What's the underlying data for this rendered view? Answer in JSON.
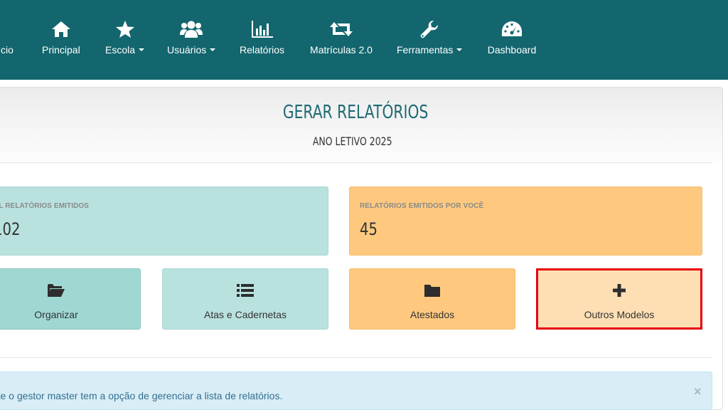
{
  "nav": {
    "partial_item_label": "cio",
    "items": [
      {
        "label": "Principal",
        "icon": "home-icon",
        "dropdown": false
      },
      {
        "label": "Escola",
        "icon": "star-icon",
        "dropdown": true
      },
      {
        "label": "Usuários",
        "icon": "users-icon",
        "dropdown": true
      },
      {
        "label": "Relatórios",
        "icon": "bar-chart-icon",
        "dropdown": false
      },
      {
        "label": "Matrículas 2.0",
        "icon": "retweet-icon",
        "dropdown": false
      },
      {
        "label": "Ferramentas",
        "icon": "wrench-icon",
        "dropdown": true
      },
      {
        "label": "Dashboard",
        "icon": "dashboard-icon",
        "dropdown": false
      }
    ]
  },
  "header": {
    "title": "GERAR RELATÓRIOS",
    "subtitle": "ANO LETIVO 2025"
  },
  "stats": {
    "total_label": "AL RELATÓRIOS EMITIDOS",
    "total_value": "102",
    "yours_label": "RELATÓRIOS EMITIDOS POR VOCÊ",
    "yours_value": "45"
  },
  "tiles": {
    "organizar": "Organizar",
    "atas": "Atas e Cadernetas",
    "atestados": "Atestados",
    "outros": "Outros Modelos"
  },
  "alert": {
    "text": "ente o gestor master tem a opção de gerenciar a lista de relatórios.",
    "close": "×"
  },
  "colors": {
    "navbar": "#13666e",
    "title": "#1f6a73",
    "teal_tile": "#b9e2df",
    "orange_tile": "#fec97f",
    "highlight_border": "#e8000b"
  }
}
